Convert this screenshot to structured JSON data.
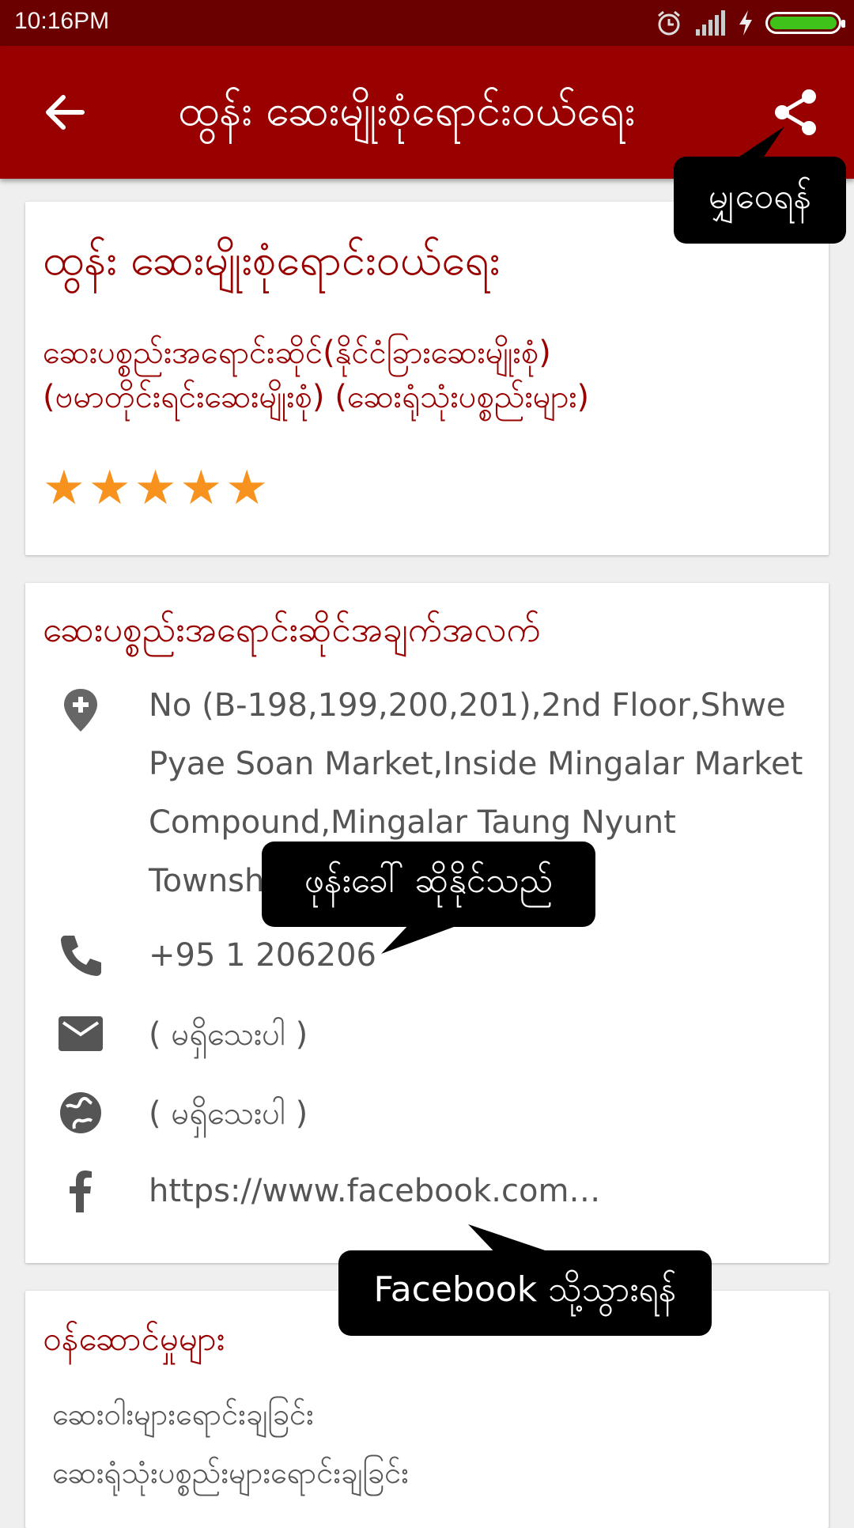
{
  "status_bar": {
    "time": "10:16PM",
    "icons": [
      "alarm-icon",
      "signal-icon",
      "charging-icon",
      "battery-icon"
    ],
    "battery_color": "#3fc31a"
  },
  "app_bar": {
    "title": "ထွန်း ဆေးမျိုးစုံရောင်းဝယ်ရေး",
    "back_icon": "arrow-back-icon",
    "share_icon": "share-icon",
    "background": "#990000"
  },
  "shop": {
    "name": "ထွန်း ဆေးမျိုးစုံရောင်းဝယ်ရေး",
    "categories": [
      "ဆေးပစ္စည်းအရောင်းဆိုင်(နိုင်ငံခြားဆေးမျိုးစုံ)",
      "(ဗမာတိုင်းရင်းဆေးမျိုးစုံ) (ဆေးရုံသုံးပစ္စည်းများ)"
    ],
    "rating": 5,
    "rating_max": 5,
    "star_color": "#f7921e"
  },
  "contact": {
    "section_title": "ဆေးပစ္စည်းအရောင်းဆိုင်အချက်အလက်",
    "address": "No (B-198,199,200,201),2nd Floor,Shwe Pyae Soan Market,Inside Mingalar Market Compound,Mingalar Taung Nyunt Township",
    "phone": "+95 1 206206",
    "email": "( မရှိသေးပါ )",
    "website": "( မရှိသေးပါ )",
    "facebook": "https://www.facebook.com…"
  },
  "services": {
    "section_title": "ဝန်ဆောင်မှုများ",
    "items": [
      "ဆေးဝါးများရောင်းချခြင်း",
      "ဆေးရုံသုံးပစ္စည်းများရောင်းချခြင်း"
    ]
  },
  "tooltips": {
    "share": "မျှဝေရန်",
    "phone": "ဖုန်းခေါ် ဆိုနိုင်သည်",
    "facebook": "Facebook သို့သွားရန်"
  }
}
